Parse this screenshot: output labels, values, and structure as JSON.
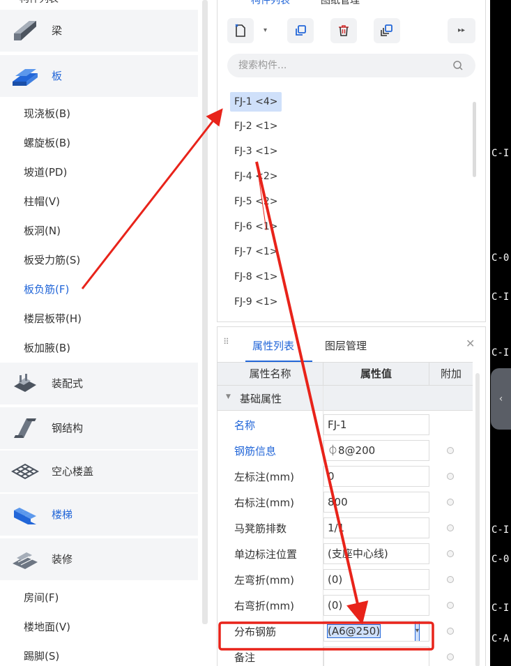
{
  "nav": {
    "header_title": "构件列表",
    "categories": [
      {
        "label": "梁"
      },
      {
        "label": "板"
      },
      {
        "label": "装配式"
      },
      {
        "label": "钢结构"
      },
      {
        "label": "空心楼盖"
      },
      {
        "label": "楼梯"
      },
      {
        "label": "装修"
      }
    ],
    "board_items": [
      "现浇板(B)",
      "螺旋板(B)",
      "坡道(PD)",
      "柱帽(V)",
      "板洞(N)",
      "板受力筋(S)",
      "板负筋(F)",
      "楼层板带(H)",
      "板加腋(B)"
    ],
    "decor_items": [
      "房间(F)",
      "楼地面(V)",
      "踢脚(S)"
    ]
  },
  "components": {
    "tab_list": "构件列表",
    "tab_drawing": "图纸管理",
    "more_label": "▸▸",
    "search_placeholder": "搜索构件...",
    "items": [
      "FJ-1 <4>",
      "FJ-2 <1>",
      "FJ-3 <1>",
      "FJ-4 <2>",
      "FJ-5 <2>",
      "FJ-6 <1>",
      "FJ-7 <1>",
      "FJ-8 <1>",
      "FJ-9 <1>"
    ]
  },
  "properties": {
    "tab_props": "属性列表",
    "tab_layers": "图层管理",
    "col_name": "属性名称",
    "col_value": "属性值",
    "col_extra": "附加",
    "group_basic": "基础属性",
    "rows": [
      {
        "name": "名称",
        "value": "FJ-1"
      },
      {
        "name": "钢筋信息",
        "value": "⏀8@200"
      },
      {
        "name": "左标注(mm)",
        "value": "0"
      },
      {
        "name": "右标注(mm)",
        "value": "800"
      },
      {
        "name": "马凳筋排数",
        "value": "1/1"
      },
      {
        "name": "单边标注位置",
        "value": "(支座中心线)"
      },
      {
        "name": "左弯折(mm)",
        "value": "(0)"
      },
      {
        "name": "右弯折(mm)",
        "value": "(0)"
      },
      {
        "name": "分布钢筋",
        "value": "(A6@250)"
      },
      {
        "name": "备注",
        "value": ""
      }
    ]
  },
  "canvas": {
    "labels": [
      "C-I",
      "C-0",
      "C-I",
      "C-I",
      "C-I",
      "C-0",
      "C-I",
      "C-A"
    ]
  },
  "colors": {
    "accent_blue": "#2266d8",
    "selection": "#cfe0fa",
    "annotation_red": "#e8231a"
  }
}
